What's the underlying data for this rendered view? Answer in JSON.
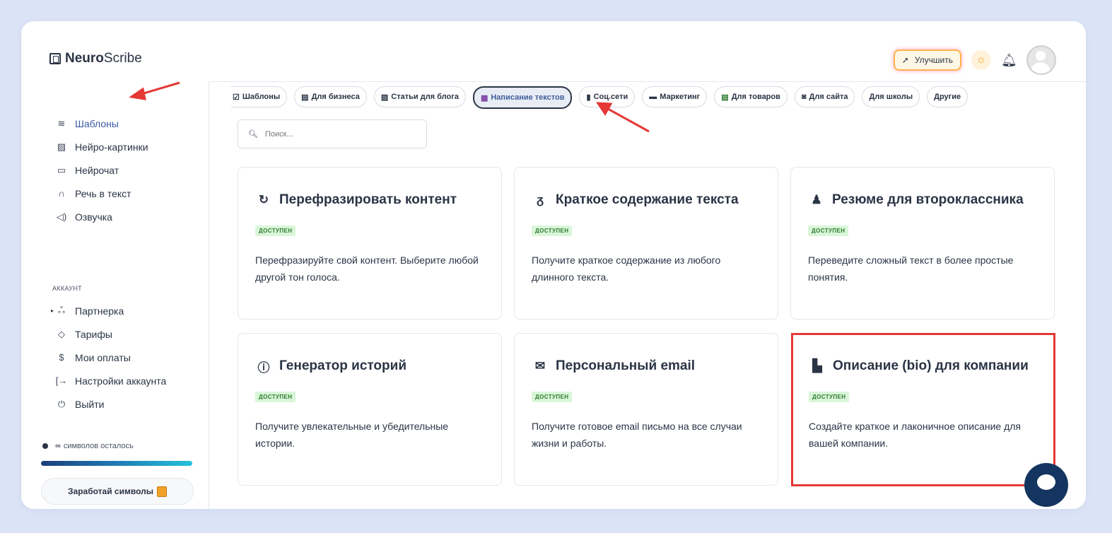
{
  "brand": {
    "name_bold": "Neuro",
    "name_rest": "Scribe"
  },
  "header": {
    "upgrade_label": "Улучшить"
  },
  "sidebar": {
    "items": [
      {
        "label": "Шаблоны",
        "icon": "layers-icon",
        "active": true
      },
      {
        "label": "Нейро-картинки",
        "icon": "image-icon"
      },
      {
        "label": "Нейрочат",
        "icon": "chat-icon"
      },
      {
        "label": "Речь в текст",
        "icon": "headphones-icon"
      },
      {
        "label": "Озвучка",
        "icon": "speaker-icon"
      }
    ],
    "account_label": "АККАУНТ",
    "account_items": [
      {
        "label": "Партнерка",
        "icon": "users-icon"
      },
      {
        "label": "Тарифы",
        "icon": "tag-icon"
      },
      {
        "label": "Мои оплаты",
        "icon": "dollar-icon"
      },
      {
        "label": "Настройки аккаунта",
        "icon": "logout-arrow-icon"
      },
      {
        "label": "Выйти",
        "icon": "power-icon"
      }
    ],
    "credits_infinity": "∞",
    "credits_text": "символов осталось",
    "earn_label": "Заработай символы"
  },
  "tabs": [
    {
      "label": "Шаблоны",
      "icon": "☑"
    },
    {
      "label": "Для бизнеса",
      "icon": "▤"
    },
    {
      "label": "Статьи для блога",
      "icon": "▨"
    },
    {
      "label": "Написание текстов",
      "icon": "▦",
      "active": true
    },
    {
      "label": "Соц.сети",
      "icon": "▮"
    },
    {
      "label": "Маркетинг",
      "icon": "▬"
    },
    {
      "label": "Для товаров",
      "icon": "▤"
    },
    {
      "label": "Для сайта",
      "icon": "◙"
    },
    {
      "label": "Для школы",
      "icon": ""
    },
    {
      "label": "Другие",
      "icon": ""
    }
  ],
  "search": {
    "placeholder": "Поиск..."
  },
  "cards": [
    {
      "title": "Перефразировать контент",
      "icon": "↻",
      "badge": "ДОСТУПЕН",
      "desc": "Перефразируйте свой контент. Выберите любой другой тон голоса."
    },
    {
      "title": "Краткое содержание текста",
      "icon": "ᵹ",
      "badge": "ДОСТУПЕН",
      "desc": "Получите краткое содержание из любого длинного текста."
    },
    {
      "title": "Резюме для второклассника",
      "icon": "♟",
      "badge": "ДОСТУПЕН",
      "desc": "Переведите сложный текст в более простые понятия."
    },
    {
      "title": "Генератор историй",
      "icon": "ⓘ",
      "badge": "ДОСТУПЕН",
      "desc": "Получите увлекательные и убедительные истории."
    },
    {
      "title": "Персональный email",
      "icon": "✉",
      "badge": "ДОСТУПЕН",
      "desc": "Получите готовое email письмо на все случаи жизни и работы."
    },
    {
      "title": "Описание (bio) для компании",
      "icon": "▙",
      "badge": "ДОСТУПЕН",
      "desc": "Создайте краткое и лаконичное описание для вашей компании."
    }
  ],
  "colors": {
    "accent": "#3b5ba5",
    "highlight": "#e53935",
    "badge_bg": "#d9f6d9",
    "annotation_arrow": "#e53935"
  }
}
